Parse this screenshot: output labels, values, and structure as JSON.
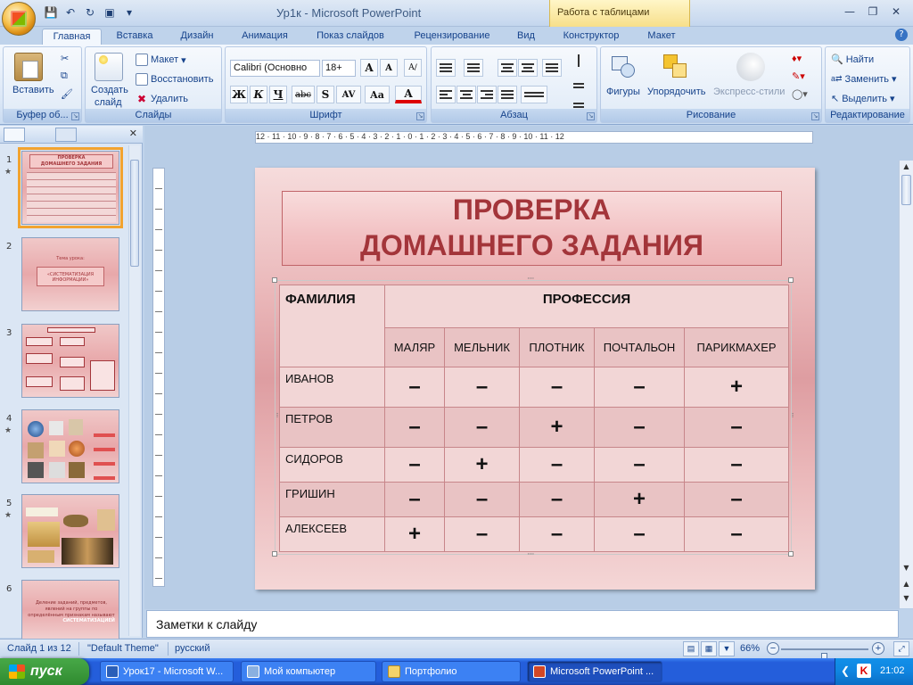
{
  "window": {
    "title": "Ур1к - Microsoft PowerPoint",
    "context_group": "Работа с таблицами"
  },
  "tabs": [
    "Главная",
    "Вставка",
    "Дизайн",
    "Анимация",
    "Показ слайдов",
    "Рецензирование",
    "Вид",
    "Конструктор",
    "Макет"
  ],
  "ribbon": {
    "clipboard": {
      "paste": "Вставить",
      "label": "Буфер об..."
    },
    "slides": {
      "new_slide_1": "Создать",
      "new_slide_2": "слайд",
      "layout": "Макет",
      "reset": "Восстановить",
      "delete": "Удалить",
      "label": "Слайды"
    },
    "font": {
      "name": "Calibri (Основно",
      "size": "18+",
      "grow": "A",
      "shrink": "A",
      "bold": "Ж",
      "italic": "К",
      "underline": "Ч",
      "strike": "abc",
      "shadow": "S",
      "spacing": "AV",
      "case": "Aa",
      "color": "A",
      "label": "Шрифт"
    },
    "paragraph": {
      "label": "Абзац"
    },
    "drawing": {
      "shapes": "Фигуры",
      "arrange": "Упорядочить",
      "quick_styles": "Экспресс-стили",
      "label": "Рисование"
    },
    "editing": {
      "find": "Найти",
      "replace": "Заменить",
      "select": "Выделить",
      "label": "Редактирование"
    }
  },
  "slides_panel": {
    "thumbs": [
      {
        "num": "1",
        "text_top": "ПРОВЕРКА",
        "text_bottom": "ДОМАШНЕГО ЗАДАНИЯ"
      },
      {
        "num": "2",
        "text_top": "Тема урока:",
        "text_bottom": "«СИСТЕМАТИЗАЦИЯ ИНФОРМАЦИИ»"
      },
      {
        "num": "3",
        "text_top": "",
        "text_bottom": ""
      },
      {
        "num": "4",
        "text_top": "",
        "text_bottom": ""
      },
      {
        "num": "5",
        "text_top": "",
        "text_bottom": ""
      },
      {
        "num": "6",
        "text_top": "Деление заданий, предметов, явлений на группы по определённым признакам называют",
        "text_bottom": "СИСТЕМАТИЗАЦИЕЙ"
      }
    ]
  },
  "ruler": {
    "h": "12 · 11 · 10 · 9 · 8 · 7 · 6 · 5 · 4 · 3 · 2 · 1 · 0 · 1 · 2 · 3 · 4 · 5 · 6 · 7 · 8 · 9 · 10 · 11 · 12"
  },
  "slide": {
    "title_1": "ПРОВЕРКА",
    "title_2": "ДОМАШНЕГО ЗАДАНИЯ",
    "table": {
      "col_surname": "ФАМИЛИЯ",
      "col_profession": "ПРОФЕССИЯ",
      "professions": [
        "МАЛЯР",
        "МЕЛЬНИК",
        "ПЛОТНИК",
        "ПОЧТАЛЬОН",
        "ПАРИКМАХЕР"
      ],
      "rows": [
        {
          "name": "ИВАНОВ",
          "cells": [
            "–",
            "–",
            "–",
            "–",
            "+"
          ]
        },
        {
          "name": "ПЕТРОВ",
          "cells": [
            "–",
            "–",
            "+",
            "–",
            "–"
          ]
        },
        {
          "name": "СИДОРОВ",
          "cells": [
            "–",
            "+",
            "–",
            "–",
            "–"
          ]
        },
        {
          "name": "ГРИШИН",
          "cells": [
            "–",
            "–",
            "–",
            "+",
            "–"
          ]
        },
        {
          "name": "АЛЕКСЕЕВ",
          "cells": [
            "+",
            "–",
            "–",
            "–",
            "–"
          ]
        }
      ]
    }
  },
  "notes": {
    "placeholder": "Заметки к слайду"
  },
  "status": {
    "slide": "Слайд 1 из 12",
    "theme": "\"Default Theme\"",
    "language": "русский",
    "zoom": "66%",
    "zoom_level": 0.5
  },
  "taskbar": {
    "start": "пуск",
    "items": [
      "Урок17 - Microsoft W...",
      "Мой компьютер",
      "Портфолио",
      "Microsoft PowerPoint ..."
    ],
    "clock": "21:02"
  },
  "colors": {
    "title": "#a3353a",
    "accent": "#f2a32f",
    "table_border": "#c7868a"
  }
}
